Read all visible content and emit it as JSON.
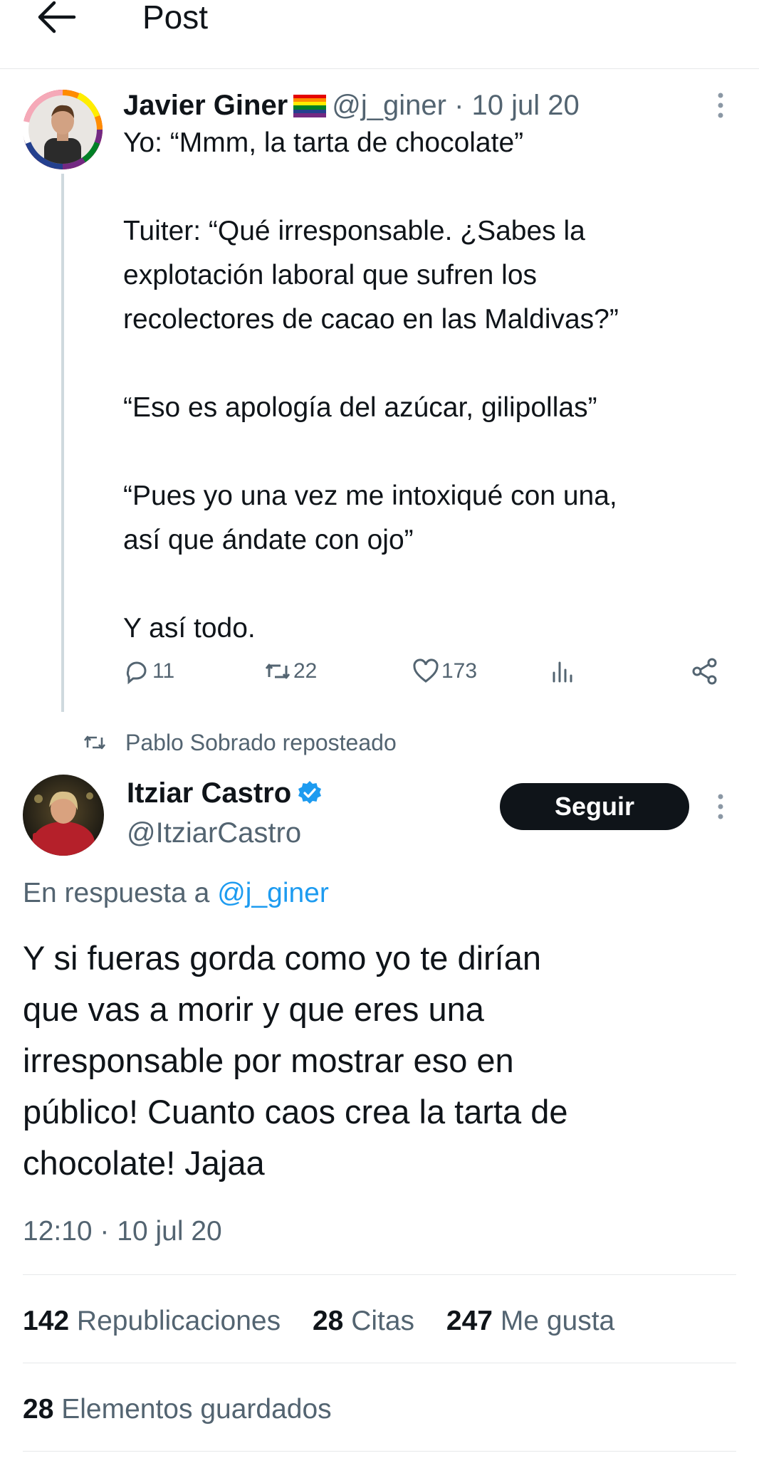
{
  "header": {
    "title": "Post"
  },
  "parent_tweet": {
    "author_name": "Javier Giner",
    "handle": "@j_giner",
    "separator": "·",
    "date": "10 jul 20",
    "lines": [
      "Yo: “Mmm, la tarta de chocolate”",
      "",
      "Tuiter: “Qué irresponsable. ¿Sabes la",
      "explotación laboral que sufren los",
      "recolectores de cacao en las Maldivas?”",
      "",
      "“Eso es apología del azúcar, gilipollas”",
      "",
      "“Pues yo una vez me intoxiqué con una,",
      "así que ándate con ojo”",
      "",
      "Y así todo."
    ],
    "actions": {
      "replies": "11",
      "reposts": "22",
      "likes": "173"
    }
  },
  "repost_context": {
    "text": "Pablo Sobrado reposteado"
  },
  "reply_tweet": {
    "author_name": "Itziar Castro",
    "handle": "@ItziarCastro",
    "follow_label": "Seguir",
    "reply_prefix": "En respuesta a",
    "reply_mention": "@j_giner",
    "body": "Y si fueras gorda como yo te dirían que vas a morir y que eres una irresponsable por mostrar eso en público! Cuanto caos crea la tarta de chocolate! Jajaa",
    "body_lines": [
      "Y si fueras gorda como yo te dirían",
      "que vas a morir y que eres una",
      "irresponsable por mostrar eso en",
      "público! Cuanto caos crea la tarta de",
      "chocolate! Jajaa"
    ],
    "timestamp": "12:10 · 10 jul 20",
    "stats": {
      "reposts_count": "142",
      "reposts_label": "Republicaciones",
      "quotes_count": "28",
      "quotes_label": "Citas",
      "likes_count": "247",
      "likes_label": "Me gusta",
      "bookmarks_count": "28",
      "bookmarks_label": "Elementos guardados"
    }
  },
  "colors": {
    "text": "#0f1419",
    "secondary": "#536471",
    "accent": "#1d9bf0",
    "divider": "#e6e8ea"
  },
  "icons": [
    "back-arrow-icon",
    "more-icon",
    "reply-icon",
    "repost-icon",
    "like-icon",
    "views-icon",
    "share-icon",
    "verified-icon"
  ]
}
